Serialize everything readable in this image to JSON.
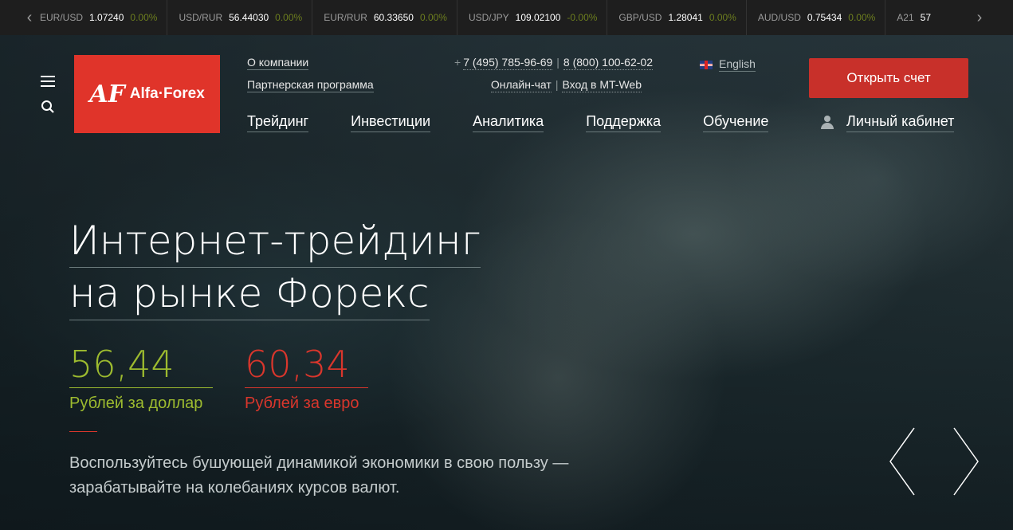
{
  "ticker": {
    "items": [
      {
        "pair": "EUR/USD",
        "rate": "1.07240",
        "change": "0.00%"
      },
      {
        "pair": "USD/RUR",
        "rate": "56.44030",
        "change": "0.00%"
      },
      {
        "pair": "EUR/RUR",
        "rate": "60.33650",
        "change": "0.00%"
      },
      {
        "pair": "USD/JPY",
        "rate": "109.02100",
        "change": "-0.00%"
      },
      {
        "pair": "GBP/USD",
        "rate": "1.28041",
        "change": "0.00%"
      },
      {
        "pair": "AUD/USD",
        "rate": "0.75434",
        "change": "0.00%"
      },
      {
        "pair": "A21",
        "rate": "57",
        "change": ""
      }
    ]
  },
  "logo": {
    "mark": "AF",
    "text": "Alfa·Forex"
  },
  "top_links": [
    "О компании",
    "Партнерская программа"
  ],
  "contacts": {
    "plus": "+",
    "phone1": "7 (495) 785-96-69",
    "phone2": "8 (800) 100-62-02",
    "chat": "Онлайн-чат",
    "mt_web": "Вход в MT-Web",
    "separator": "|"
  },
  "lang": {
    "label": "English"
  },
  "open_account_label": "Открыть счет",
  "nav": [
    "Трейдинг",
    "Инвестиции",
    "Аналитика",
    "Поддержка",
    "Обучение"
  ],
  "cabinet_label": "Личный кабинет",
  "hero": {
    "title_line1": "Интернет-трейдинг",
    "title_line2": "на рынке Форекс",
    "usd_value": "56,44",
    "usd_caption": "Рублей за доллар",
    "eur_value": "60,34",
    "eur_caption": "Рублей за евро",
    "desc_line1": "Воспользуйтесь бушующей динамикой экономики в свою пользу —",
    "desc_line2": "зарабатывайте на колебаниях курсов валют."
  },
  "colors": {
    "brand_red": "#e0342a",
    "usd_green": "#9dbb2f",
    "eur_red": "#d9362c"
  }
}
